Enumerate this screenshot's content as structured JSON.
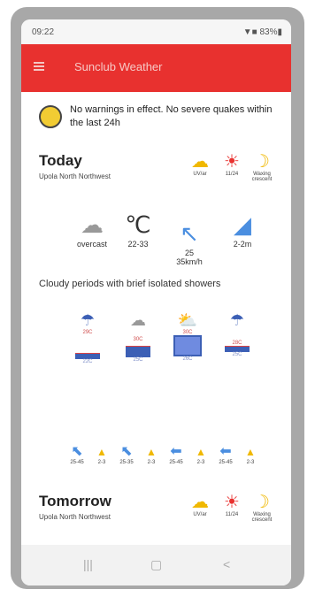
{
  "status_bar": {
    "time": "09:22",
    "right": "▼■ 83%▮"
  },
  "app": {
    "title": "Sunclub Weather"
  },
  "notice": {
    "text": "No warnings in effect. No severe quakes within the last 24h"
  },
  "today": {
    "title": "Today",
    "location": "Upola North Northwest",
    "summary": [
      {
        "icon": "sun-cloud-icon",
        "glyph": "☁",
        "label": "UV/ar"
      },
      {
        "icon": "hot-thermometer-icon",
        "glyph": "☀",
        "label": "11/24"
      },
      {
        "icon": "moon-icon",
        "glyph": "☽",
        "label": "Waxing crescent"
      }
    ],
    "conditions": [
      {
        "icon": "cloud-icon",
        "glyph": "☁",
        "label": "overcast"
      },
      {
        "icon": "thermometer-icon",
        "glyph": "℃",
        "label": "22-33"
      },
      {
        "icon": "wind-arrow-icon",
        "glyph": "↖",
        "label": "25\n35km/h"
      },
      {
        "icon": "wave-icon",
        "glyph": "◢",
        "label": "2-2m"
      }
    ],
    "description": "Cloudy periods with brief isolated showers",
    "periods": [
      {
        "glyph": "☂",
        "high": "29C",
        "low": "22C"
      },
      {
        "glyph": "☁",
        "high": "30C",
        "low": "25C"
      },
      {
        "glyph": "⛅",
        "high": "30C",
        "low": "26C"
      },
      {
        "glyph": "☂",
        "high": "28C",
        "low": "25C"
      }
    ],
    "wind": [
      "25-45",
      "2-3",
      "25-35",
      "2-3",
      "25-45",
      "2-3",
      "25-45",
      "2-3"
    ]
  },
  "tomorrow": {
    "title": "Tomorrow",
    "location": "Upola North Northwest",
    "summary": [
      {
        "icon": "sun-cloud-icon",
        "glyph": "☁",
        "label": "UV/ar"
      },
      {
        "icon": "hot-thermometer-icon",
        "glyph": "☀",
        "label": "11/24"
      },
      {
        "icon": "moon-icon",
        "glyph": "☽",
        "label": "Waxing crescent"
      }
    ]
  },
  "nav": {
    "recents": "|||",
    "home": "▢",
    "back": "<"
  },
  "colors": {
    "accent": "#e8312f",
    "sun": "#f0b800",
    "wind": "#4a8ee0"
  }
}
